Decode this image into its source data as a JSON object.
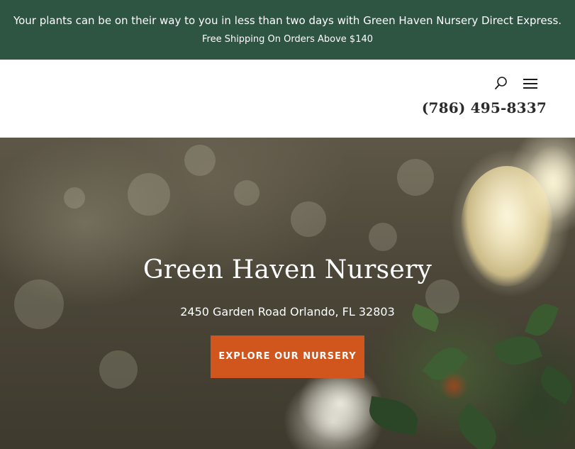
{
  "promo": {
    "message": "Your plants can be on their way to you in less than two days with Green Haven Nursery Direct Express.",
    "shipping": "Free Shipping On Orders Above $140"
  },
  "header": {
    "search_icon": "search-icon",
    "menu_icon": "hamburger-menu-icon",
    "phone": "(786) 495-8337"
  },
  "hero": {
    "title": "Green Haven Nursery",
    "address": "2450 Garden Road Orlando, FL 32803",
    "cta_label": "EXPLORE OUR NURSERY"
  },
  "colors": {
    "promo_bg": "#2e5442",
    "cta_bg": "#d1561e",
    "text_light": "#ffffff"
  }
}
